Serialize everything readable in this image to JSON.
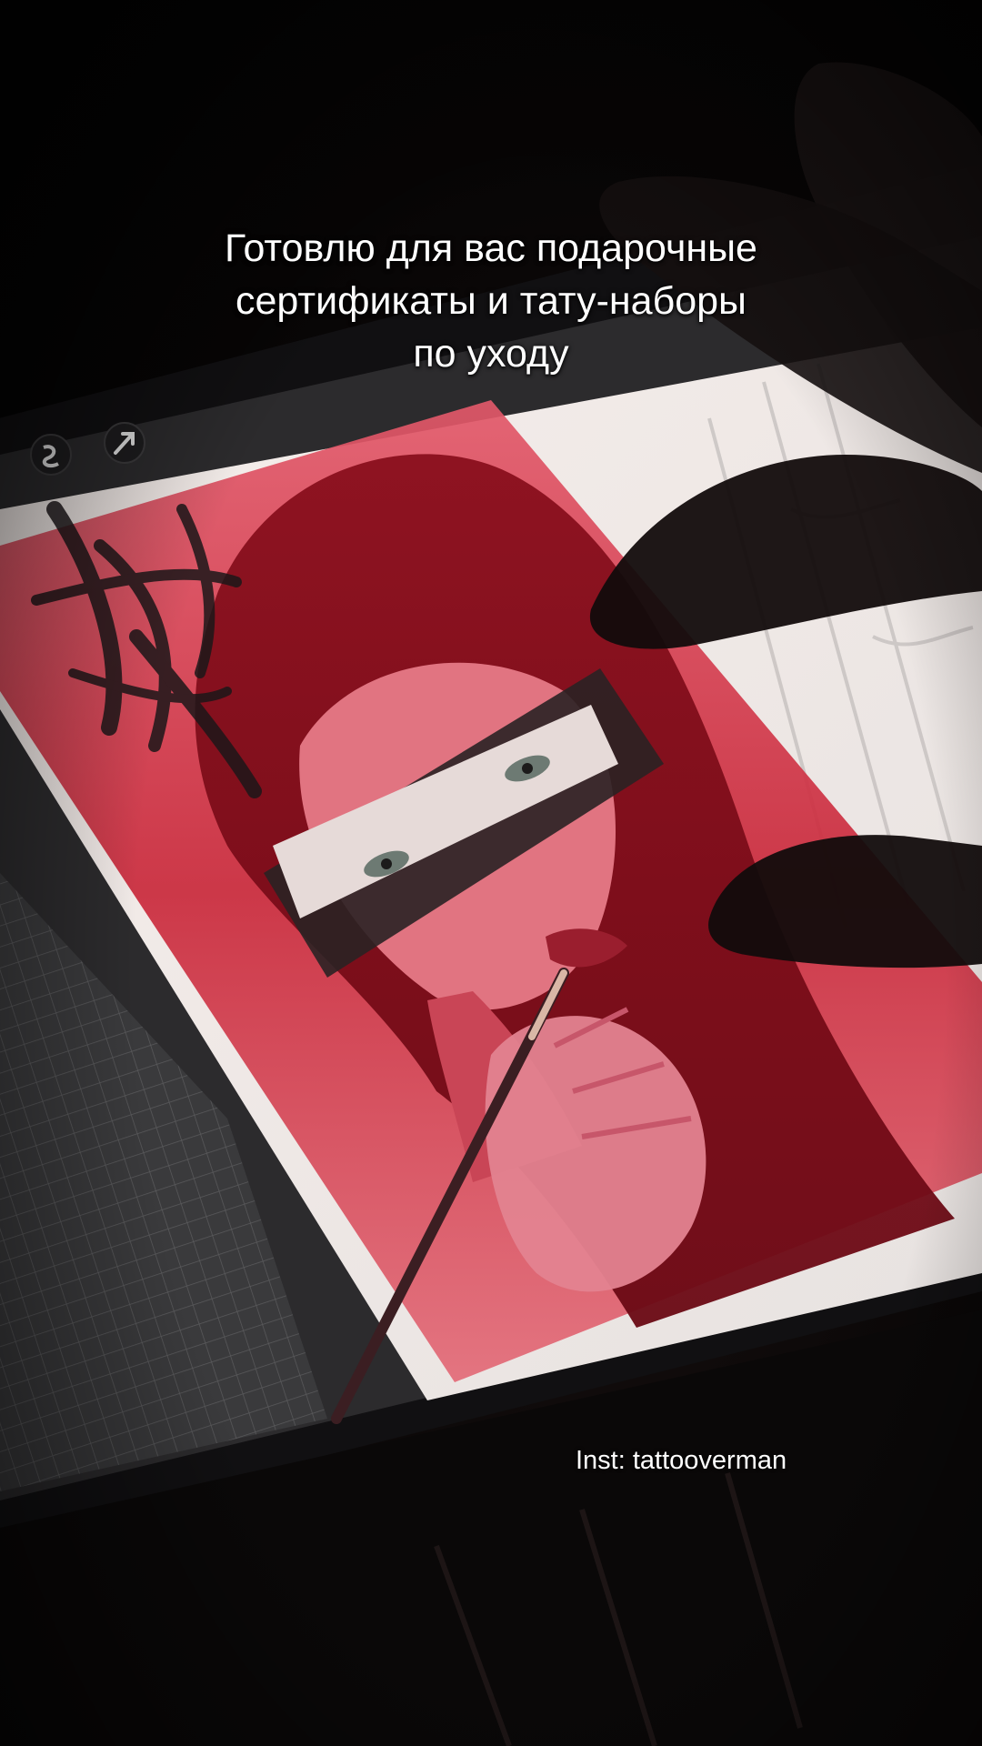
{
  "overlay": {
    "caption_lines": [
      "Готовлю для вас подарочные",
      "сертификаты и тату-наборы",
      "по уходу"
    ],
    "handle": "Inst: tattooverman"
  },
  "photo": {
    "subject": "tablet-with-red-portrait-sketch",
    "accent_color": "#d21e2d",
    "paper_color": "#f4ede9",
    "toolbar_icons": [
      "smudge-icon",
      "selection-arrow-icon"
    ]
  }
}
